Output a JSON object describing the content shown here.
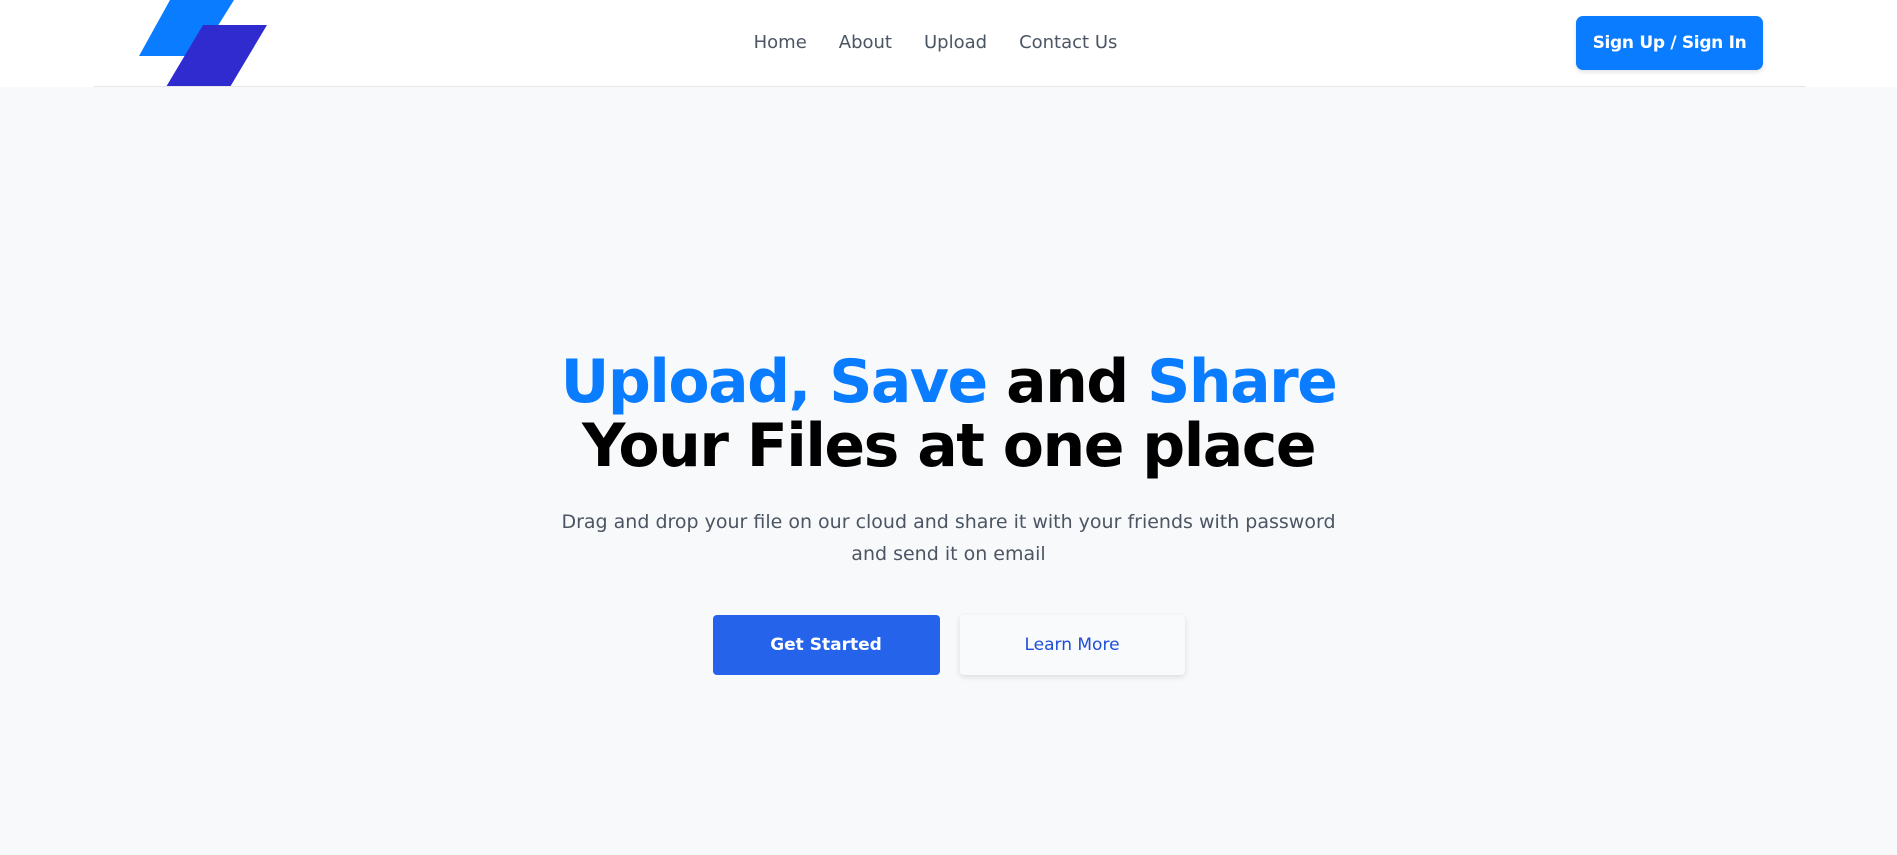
{
  "brand": {
    "logo_icon": "stacked-parallelograms-logo-icon",
    "colors": {
      "primary": "#0a7cff",
      "secondary": "#2f2bcf",
      "cta": "#2563eb"
    }
  },
  "nav": {
    "items": [
      {
        "label": "Home"
      },
      {
        "label": "About"
      },
      {
        "label": "Upload"
      },
      {
        "label": "Contact Us"
      }
    ],
    "signin_label": "Sign Up / Sign In"
  },
  "hero": {
    "title_part1": "Upload, Save",
    "title_part2": " and ",
    "title_part3": "Share",
    "title_line2": "Your Files at one place",
    "subtitle": "Drag and drop your file on our cloud and share it with your friends with password and send it on email",
    "primary_cta": "Get Started",
    "secondary_cta": "Learn More"
  }
}
